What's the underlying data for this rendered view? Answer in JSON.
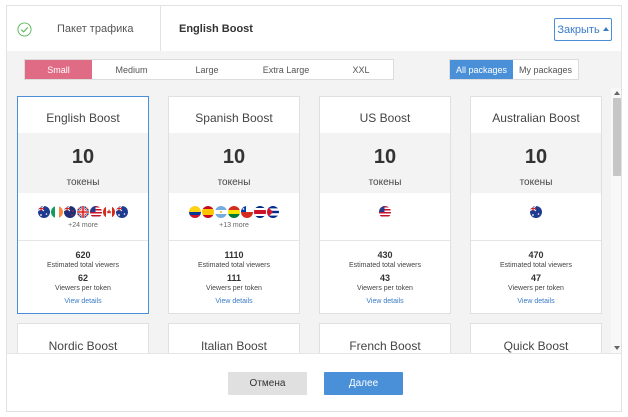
{
  "header": {
    "step_label": "Пакет трафика",
    "step_title": "English Boost",
    "close_label": "Закрыть"
  },
  "size_tabs": [
    "Small",
    "Medium",
    "Large",
    "Extra Large",
    "XXL"
  ],
  "size_tab_active": "Small",
  "view_tabs": [
    "All packages",
    "My packages"
  ],
  "view_tab_active": "All packages",
  "cards": [
    {
      "name": "English Boost",
      "tokens": "10",
      "unit": "токены",
      "flags": [
        "australia-flag-icon",
        "ireland-flag-icon",
        "new-zealand-flag-icon",
        "uk-flag-icon",
        "usa-flag-icon",
        "canada-flag-icon",
        "australia-flag-icon"
      ],
      "more": "+24 more",
      "total_viewers": "620",
      "total_viewers_label": "Estimated total viewers",
      "per_token": "62",
      "per_token_label": "Viewers per token",
      "details": "View details",
      "selected": true
    },
    {
      "name": "Spanish Boost",
      "tokens": "10",
      "unit": "токены",
      "flags": [
        "colombia-flag-icon",
        "spain-flag-icon",
        "argentina-flag-icon",
        "bolivia-flag-icon",
        "chile-flag-icon",
        "costa-rica-flag-icon",
        "cuba-flag-icon"
      ],
      "more": "+13 more",
      "total_viewers": "1110",
      "total_viewers_label": "Estimated total viewers",
      "per_token": "111",
      "per_token_label": "Viewers per token",
      "details": "View details",
      "selected": false
    },
    {
      "name": "US Boost",
      "tokens": "10",
      "unit": "токены",
      "flags": [
        "usa-flag-icon"
      ],
      "more": "",
      "total_viewers": "430",
      "total_viewers_label": "Estimated total viewers",
      "per_token": "43",
      "per_token_label": "Viewers per token",
      "details": "View details",
      "selected": false
    },
    {
      "name": "Australian Boost",
      "tokens": "10",
      "unit": "токены",
      "flags": [
        "australia-flag-icon"
      ],
      "more": "",
      "total_viewers": "470",
      "total_viewers_label": "Estimated total viewers",
      "per_token": "47",
      "per_token_label": "Viewers per token",
      "details": "View details",
      "selected": false
    }
  ],
  "cards_next_row": [
    "Nordic Boost",
    "Italian Boost",
    "French Boost",
    "Quick Boost"
  ],
  "footer": {
    "cancel_label": "Отмена",
    "next_label": "Далее"
  },
  "colors": {
    "accent_blue": "#4a90d9",
    "accent_pink": "#e06b85",
    "success_green": "#5cb85c"
  }
}
